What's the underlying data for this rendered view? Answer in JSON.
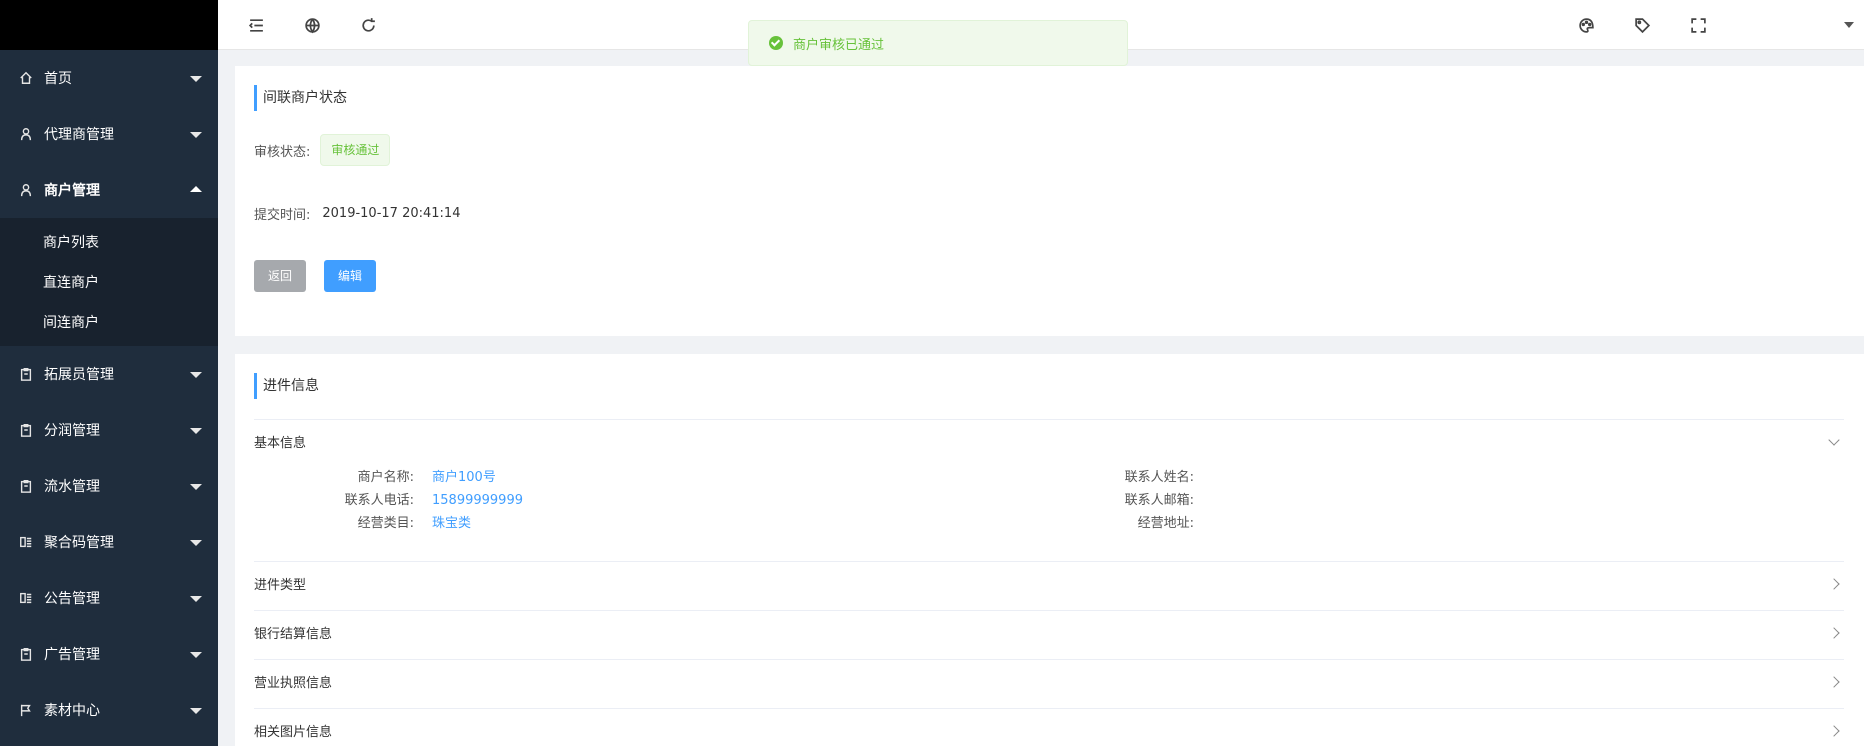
{
  "sidebar": {
    "items": [
      {
        "label": "首页",
        "icon": "home-icon"
      },
      {
        "label": "代理商管理",
        "icon": "user-icon"
      },
      {
        "label": "商户管理",
        "icon": "user-icon",
        "open": true,
        "children": [
          "商户列表",
          "直连商户",
          "间连商户"
        ]
      },
      {
        "label": "拓展员管理",
        "icon": "clipboard-icon"
      },
      {
        "label": "分润管理",
        "icon": "clipboard-icon"
      },
      {
        "label": "流水管理",
        "icon": "clipboard-icon"
      },
      {
        "label": "聚合码管理",
        "icon": "qr-icon"
      },
      {
        "label": "公告管理",
        "icon": "qr-icon"
      },
      {
        "label": "广告管理",
        "icon": "clipboard-icon"
      },
      {
        "label": "素材中心",
        "icon": "flag-icon"
      }
    ]
  },
  "toast": {
    "message": "商户审核已通过"
  },
  "status_card": {
    "title": "间联商户状态",
    "audit_label": "审核状态:",
    "audit_value": "审核通过",
    "submit_label": "提交时间:",
    "submit_value": "2019-10-17 20:41:14",
    "back_label": "返回",
    "edit_label": "编辑"
  },
  "info_card": {
    "title": "进件信息",
    "basic": {
      "title": "基本信息",
      "left": [
        {
          "k": "商户名称:",
          "v": "商户100号"
        },
        {
          "k": "联系人电话:",
          "v": "15899999999"
        },
        {
          "k": "经营类目:",
          "v": "珠宝类"
        }
      ],
      "right": [
        {
          "k": "联系人姓名:",
          "v": ""
        },
        {
          "k": "联系人邮箱:",
          "v": ""
        },
        {
          "k": "经营地址:",
          "v": ""
        }
      ]
    },
    "sections": [
      "进件类型",
      "银行结算信息",
      "营业执照信息",
      "相关图片信息"
    ]
  },
  "colors": {
    "accent": "#409eff",
    "success": "#67c23a",
    "sidebar": "#1f2d3d"
  }
}
